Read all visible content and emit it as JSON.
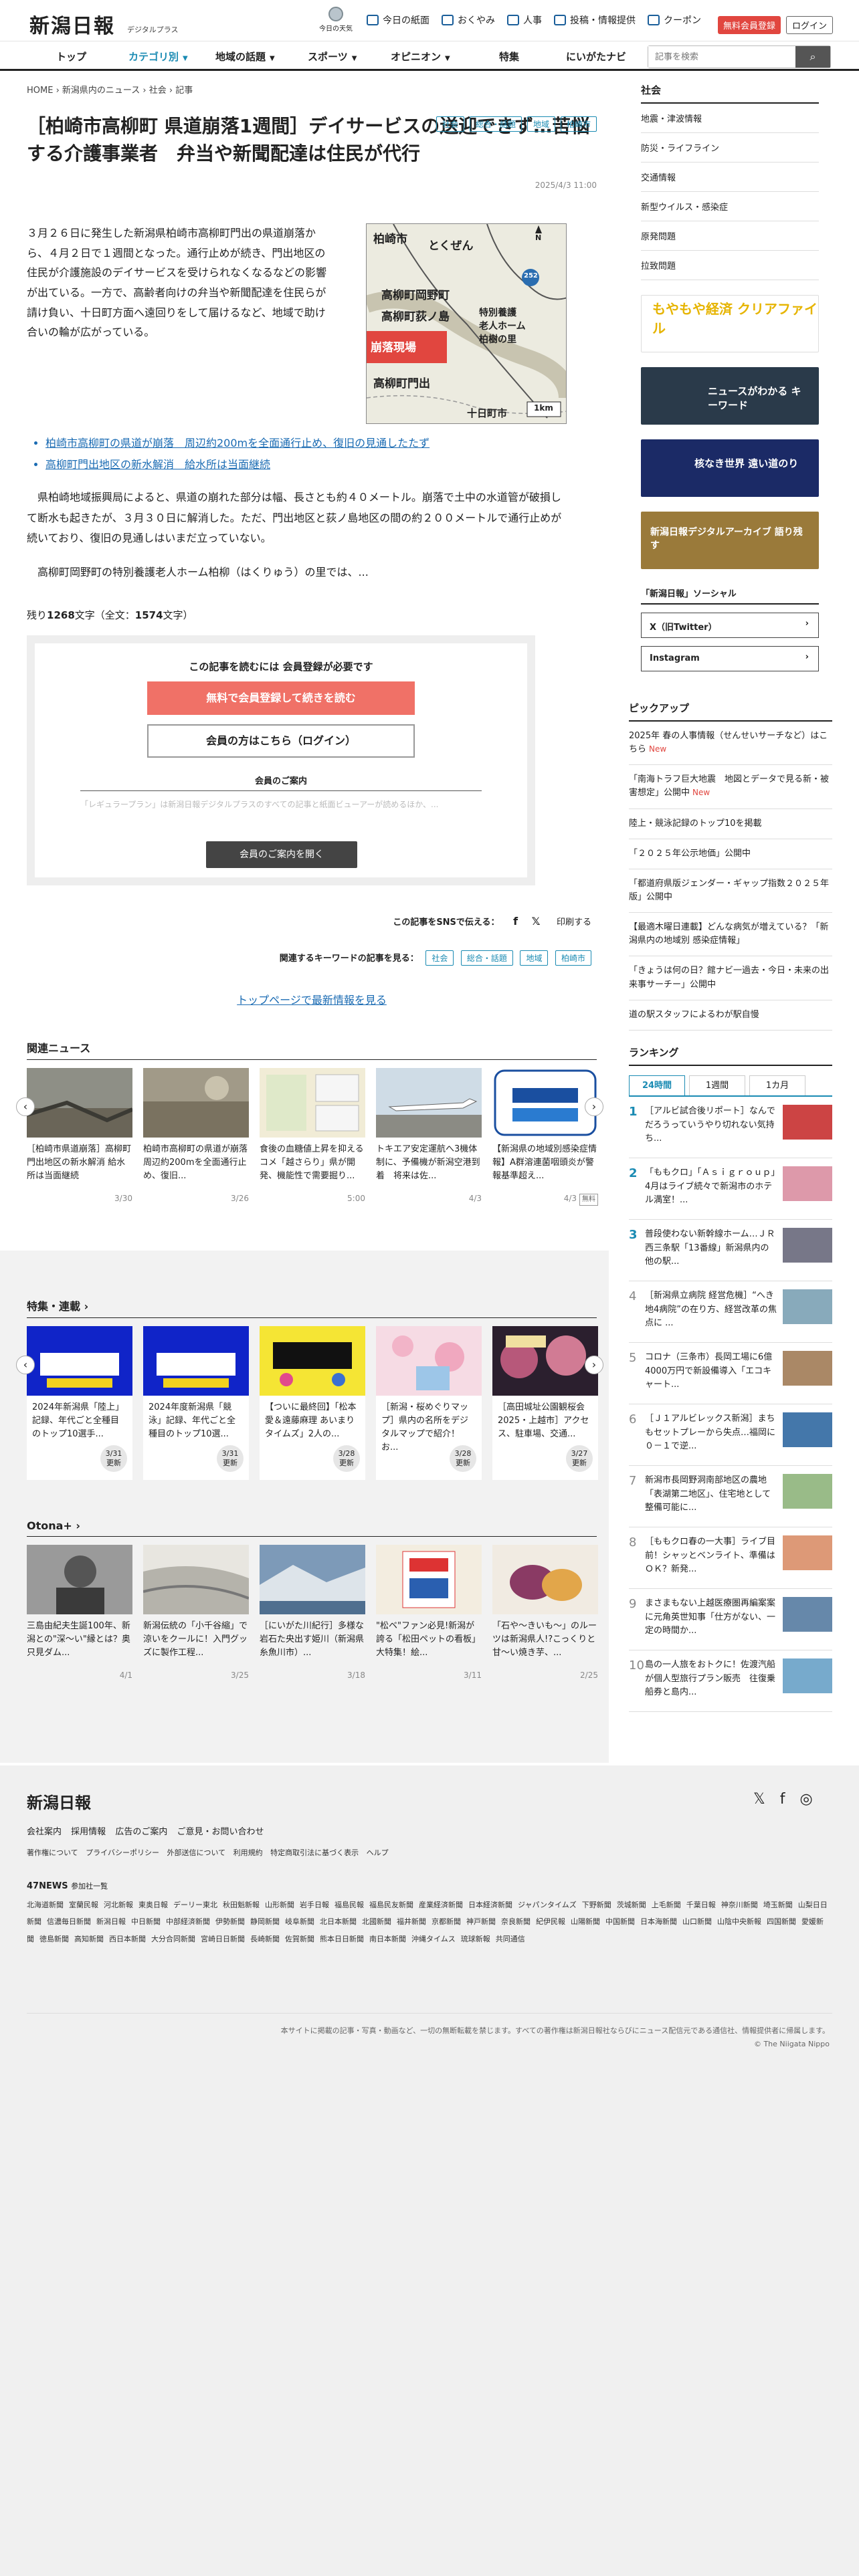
{
  "header": {
    "logo": "新潟日報",
    "logo_sub": "デジタルプラス",
    "weather_label": "今日の天気",
    "links": [
      "今日の紙面",
      "おくやみ",
      "人事",
      "投稿・情報提供",
      "クーポン"
    ],
    "register": "無料会員登録",
    "login": "ログイン"
  },
  "nav": {
    "items": [
      "トップ",
      "カテゴリ別",
      "地域の話題",
      "スポーツ",
      "オピニオン",
      "特集",
      "にいがたナビ"
    ],
    "search_placeholder": "記事を検索"
  },
  "article": {
    "breadcrumb": [
      "HOME",
      "新潟県内のニュース",
      "社会",
      "記事"
    ],
    "tags": [
      "社会",
      "総合・話題",
      "地域",
      "柏崎市"
    ],
    "title": "［柏崎市高柳町 県道崩落1週間］デイサービスの送迎できず…苦悩する介護事業者　弁当や新聞配達は住民が代行",
    "date": "2025/4/3 11:00",
    "lead": "３月２６日に発生した新潟県柏崎市高柳町門出の県道崩落から、４月２日で１週間となった。通行止めが続き、門出地区の住民が介護施設のデイサービスを受けられなくなるなどの影響が出ている。一方で、高齢者向けの弁当や新聞配達を住民らが請け負い、十日町方面へ遠回りをして届けるなど、地域で助け合いの輪が広がっている。",
    "map_labels": [
      "柏崎市",
      "とくぜん",
      "高柳町岡野町",
      "高柳町荻ノ島",
      "崩落現場",
      "高柳町門出",
      "特別養護",
      "老人ホーム",
      "柏樹の里",
      "十日町市",
      "1km",
      "N",
      "252"
    ],
    "related": [
      "柏崎市高柳町の県道が崩落　周辺約200mを全面通行止め、復旧の見通したたず",
      "高柳町門出地区の新水解消　給水所は当面継続"
    ],
    "body": [
      "県柏崎地域振興局によると、県道の崩れた部分は幅、長さとも約４０メートル。崩落で土中の水道管が破損して断水も起きたが、３月３０日に解消した。ただ、門出地区と荻ノ島地区の間の約２００メートルで通行止めが続いており、復旧の見通しはいまだ立っていない。",
      "高柳町岡野町の特別養護老人ホーム柏柳（はくりゅう）の里では、..."
    ],
    "count_prefix": "残り",
    "count_remaining": "1268",
    "count_mid": "文字（全文：",
    "count_total": "1574",
    "count_suffix": "文字）"
  },
  "paywall": {
    "title": "この記事を読むには 会員登録が必要です",
    "register_btn": "無料で会員登録して続きを読む",
    "login_btn": "会員の方はこちら（ログイン）",
    "guide": "会員のご案内",
    "faded": "「レギュラープラン」は新潟日報デジタルプラスのすべての記事と紙面ビューアーが読めるほか、...",
    "open_btn": "会員のご案内を開く"
  },
  "share": {
    "label": "この記事をSNSで伝える：",
    "print": "印刷する"
  },
  "keywords": {
    "label": "関連するキーワードの記事を見る：",
    "items": [
      "社会",
      "総合・話題",
      "地域",
      "柏崎市"
    ]
  },
  "latest_link": "トップページで最新情報を見る",
  "related_news": {
    "heading": "関連ニュース",
    "items": [
      {
        "text": "［柏崎市県道崩落］高柳町門出地区の新水解消 給水所は当面継続",
        "date": "3/30"
      },
      {
        "text": "柏崎市高柳町の県道が崩落　周辺約200mを全面通行止め、復旧...",
        "date": "3/26"
      },
      {
        "text": "食後の血糖値上昇を抑えるコメ「越さらり」県が開発、機能性で需要掘り...",
        "date": "5:00"
      },
      {
        "text": "トキエア安定運航へ3機体制に、予備機が新潟空港到着　将来は佐...",
        "date": "4/3"
      },
      {
        "text": "【新潟県の地域別感染症情報】A群溶連菌咽頭炎が警報基準超え...",
        "date": "4/3",
        "badge": "無料"
      }
    ]
  },
  "features": {
    "heading": "特集・連載",
    "items": [
      {
        "text": "2024年新潟県「陸上」記録、年代ごと全種目のトップ10選手...",
        "date": "3/31",
        "upd": "更新"
      },
      {
        "text": "2024年度新潟県「競泳」記録、年代ごと全種目のトップ10選...",
        "date": "3/31",
        "upd": "更新"
      },
      {
        "text": "【ついに最終回】「松本愛＆遠藤麻理 あいまりタイムズ」2人の...",
        "date": "3/28",
        "upd": "更新"
      },
      {
        "text": "［新潟・桜めぐりマップ］県内の名所をデジタルマップで紹介！お...",
        "date": "3/28",
        "upd": "更新"
      },
      {
        "text": "［高田城址公園観桜会2025・上越市］アクセス、駐車場、交通...",
        "date": "3/27",
        "upd": "更新"
      }
    ]
  },
  "otona": {
    "heading": "Otona+",
    "items": [
      {
        "text": "三島由紀夫生誕100年、新潟との\"深～い\"縁とは？奥只見ダム...",
        "date": "4/1"
      },
      {
        "text": "新潟伝統の「小千谷縮」で涼いをクールに！入門グッズに製作工程...",
        "date": "3/25"
      },
      {
        "text": "［にいがた川紀行］多様な岩石た央出す姫川（新潟県糸魚川市）...",
        "date": "3/18"
      },
      {
        "text": "\"松ベ\"ファン必見!新潟が誇る「松田ペットの看板」大特集！絵...",
        "date": "3/11"
      },
      {
        "text": "「石や～きいも～」のルーツは新潟県人!?こっくりと甘～い焼き芋、...",
        "date": "2/25"
      }
    ]
  },
  "sidebar": {
    "heading": "社会",
    "list": [
      "地震・津波情報",
      "防災・ライフライン",
      "交通情報",
      "新型ウイルス・感染症",
      "原発問題",
      "拉致問題"
    ],
    "banners": [
      "もやもや経済 クリアファイル",
      "ニュースがわかる キーワード",
      "核なき世界 遠い道のり",
      "新潟日報デジタルアーカイブ 語り残す"
    ],
    "social_heading": "「新潟日報」ソーシャル",
    "social": [
      "X（旧Twitter）",
      "Instagram"
    ],
    "pickup_heading": "ピックアップ",
    "pickup": [
      {
        "text": "2025年 春の人事情報（せんせいサーチなど）はこちら",
        "new": "New"
      },
      {
        "text": "「南海トラフ巨大地震　地図とデータで見る新・被害想定」公開中",
        "new": "New"
      },
      {
        "text": "陸上・競泳記録のトップ10を掲載"
      },
      {
        "text": "「２０２５年公示地価」公開中"
      },
      {
        "text": "「都道府県版ジェンダー・ギャップ指数２０２５年版」公開中"
      },
      {
        "text": "【最適木曜日連載】どんな病気が増えている？「新潟県内の地域別 感染症情報」"
      },
      {
        "text": "「きょうは何の日？館ナビ一過去・今日・未来の出来事サーチー」公開中"
      },
      {
        "text": "道の駅スタッフによるわが駅自慢"
      }
    ],
    "ranking_heading": "ランキング",
    "ranking_tabs": [
      "24時間",
      "1週間",
      "1カ月"
    ],
    "ranking": [
      "［アルビ試合後リポート］なんでだろうっていうやり切れない気持ち...",
      "「ももクロ」「Ａｓｉｇｒｏｕｐ」4月はライブ続々で新潟市のホテル満室！...",
      "普段使わない新幹線ホーム…ＪＲ西三条駅「13番線」新潟県内の他の駅...",
      "［新潟県立病院 経営危機］“へき地4病院”の在り方、経営改革の焦点に ...",
      "コロナ（三条市）長岡工場に6億4000万円で新設備導入「エコキャート...",
      "［Ｊ１アルビレックス新潟］まちもセットプレーから失点…福岡に０－１で逆...",
      "新潟市長岡野洞南部地区の農地「表湖第二地区」、住宅地として整備可能に...",
      "［ももクロ春の一大事］ライブ目前！シャッとベンライト、準備はＯＫ？新発...",
      "まさまもない上越医療圏再編案案に元角英世知事「仕方がない、一定の時間か...",
      "島の一人旅をおトクに！佐渡汽船が個人型旅行プラン販売　往復乗船券と島内..."
    ]
  },
  "footer": {
    "logo": "新潟日報",
    "links1": [
      "会社案内",
      "採用情報",
      "広告のご案内",
      "ご意見・お問い合わせ"
    ],
    "links2": [
      "著作権について",
      "プライバシーポリシー",
      "外部送信について",
      "利用規約",
      "特定商取引法に基づく表示",
      "ヘルプ"
    ],
    "news47": "47NEWS",
    "news47_sub": "参加社一覧",
    "papers": [
      "北海道新聞",
      "室蘭民報",
      "河北新報",
      "東奥日報",
      "デーリー東北",
      "秋田魁新報",
      "山形新聞",
      "岩手日報",
      "福島民報",
      "福島民友新聞",
      "産業経済新聞",
      "日本経済新聞",
      "ジャパンタイムズ",
      "下野新聞",
      "茨城新聞",
      "上毛新聞",
      "千葉日報",
      "神奈川新聞",
      "埼玉新聞",
      "山梨日日新聞",
      "信濃毎日新聞",
      "新潟日報",
      "中日新聞",
      "中部経済新聞",
      "伊勢新聞",
      "静岡新聞",
      "岐阜新聞",
      "北日本新聞",
      "北國新聞",
      "福井新聞",
      "京都新聞",
      "神戸新聞",
      "奈良新聞",
      "紀伊民報",
      "山陽新聞",
      "中国新聞",
      "日本海新聞",
      "山口新聞",
      "山陰中央新報",
      "四国新聞",
      "愛媛新聞",
      "徳島新聞",
      "高知新聞",
      "西日本新聞",
      "大分合同新聞",
      "宮崎日日新聞",
      "長崎新聞",
      "佐賀新聞",
      "熊本日日新聞",
      "南日本新聞",
      "沖縄タイムス",
      "琉球新報",
      "共同通信"
    ],
    "copy1": "本サイトに掲載の記事・写真・動画など、一切の無断転載を禁じます。すべての著作権は新潟日報社ならびにニュース配信元である通信社、情報提供者に帰属します。",
    "copy2": "© The Niigata Nippo"
  }
}
